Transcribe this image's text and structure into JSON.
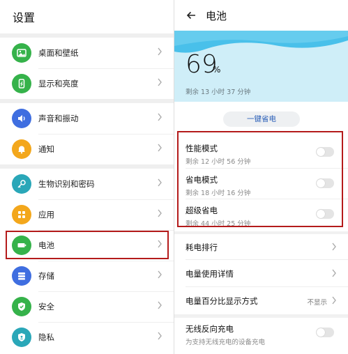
{
  "left": {
    "title": "设置",
    "items": [
      {
        "label": "桌面和壁纸",
        "icon": "image-icon",
        "color": "#35b24a"
      },
      {
        "label": "显示和亮度",
        "icon": "phone-icon",
        "color": "#35b24a"
      },
      {
        "label": "声音和振动",
        "icon": "speaker-icon",
        "color": "#3f6ee0"
      },
      {
        "label": "通知",
        "icon": "bell-icon",
        "color": "#f3a71c"
      },
      {
        "label": "生物识别和密码",
        "icon": "key-icon",
        "color": "#2aa7b8"
      },
      {
        "label": "应用",
        "icon": "grid-icon",
        "color": "#f3a71c"
      },
      {
        "label": "电池",
        "icon": "battery-icon",
        "color": "#35b24a"
      },
      {
        "label": "存储",
        "icon": "storage-icon",
        "color": "#3f6ee0"
      },
      {
        "label": "安全",
        "icon": "shield-icon",
        "color": "#35b24a"
      },
      {
        "label": "隐私",
        "icon": "privacy-icon",
        "color": "#2aa7b8"
      }
    ]
  },
  "right": {
    "title": "电池",
    "battery": {
      "percent": "69",
      "percent_sign": "%",
      "remaining": "剩余 13 小时 37 分钟"
    },
    "one_click": "一键省电",
    "modes": [
      {
        "title": "性能模式",
        "sub": "剩余 12 小时 56 分钟",
        "on": false
      },
      {
        "title": "省电模式",
        "sub": "剩余 18 小时 16 分钟",
        "on": false
      },
      {
        "title": "超级省电",
        "sub": "剩余 44 小时 25 分钟",
        "on": false
      }
    ],
    "list": [
      {
        "title": "耗电排行",
        "value": ""
      },
      {
        "title": "电量使用详情",
        "value": ""
      },
      {
        "title": "电量百分比显示方式",
        "value": "不显示"
      }
    ],
    "wireless": {
      "title": "无线反向充电",
      "sub": "为支持无线充电的设备充电",
      "on": false
    }
  },
  "colors": {
    "highlight": "#b41b1b",
    "accent": "#2a5fb8",
    "battery_bg": "#cfeef8"
  }
}
